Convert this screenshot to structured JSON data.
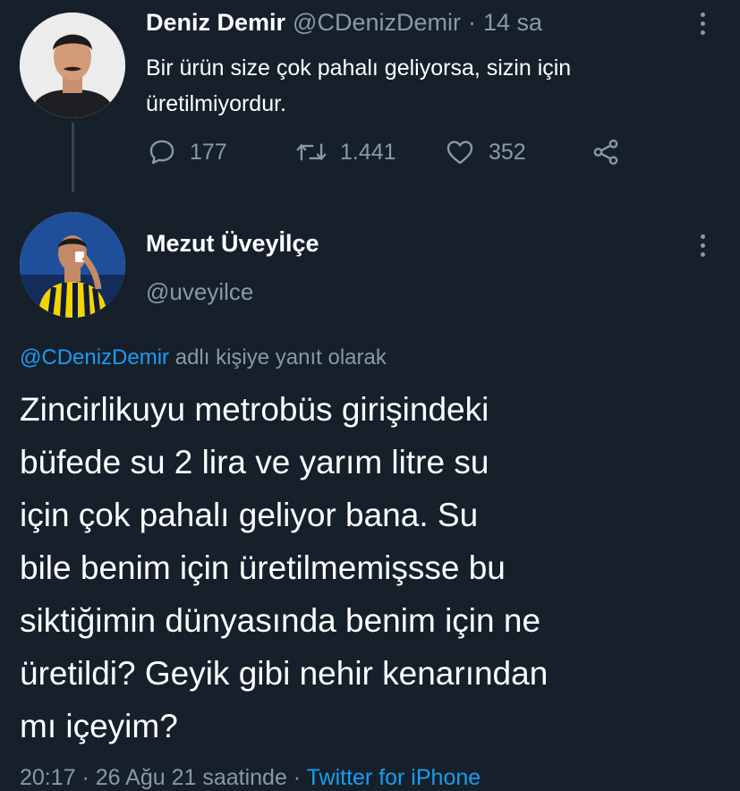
{
  "original": {
    "author_name": "Deniz Demir",
    "handle": "@CDenizDemir",
    "separator": "·",
    "time": "14 sa",
    "text_line1": "Bir ürün size çok pahalı geliyorsa, sizin için",
    "text_line2": "üretilmiyordur.",
    "reply_icon": "comment-icon",
    "replies": "177",
    "retweet_icon": "retweet-icon",
    "retweets": "1.441",
    "like_icon": "heart-icon",
    "likes": "352",
    "share_icon": "share-icon"
  },
  "reply": {
    "author_name": "Mezut Üveyİlçe",
    "handle": "@uveyilce",
    "replying_to_handle": "@CDenizDemir",
    "replying_to_suffix": "adlı kişiye yanıt olarak",
    "text_lines": [
      "Zincirlikuyu metrobüs girişindeki",
      "büfede su 2 lira ve yarım litre su",
      "için çok pahalı geliyor bana. Su",
      "bile benim için üretilmemişsse bu",
      "siktiğimin dünyasında benim için ne",
      "üretildi?  Geyik gibi nehir kenarından",
      "mı içeyim?"
    ],
    "timestamp": "20:17 · 26 Ağu 21 saatinde ·",
    "source": "Twitter for iPhone"
  },
  "colors": {
    "background": "#15202b",
    "text": "#ffffff",
    "muted": "#8b98a5",
    "link": "#1d9bf0"
  }
}
